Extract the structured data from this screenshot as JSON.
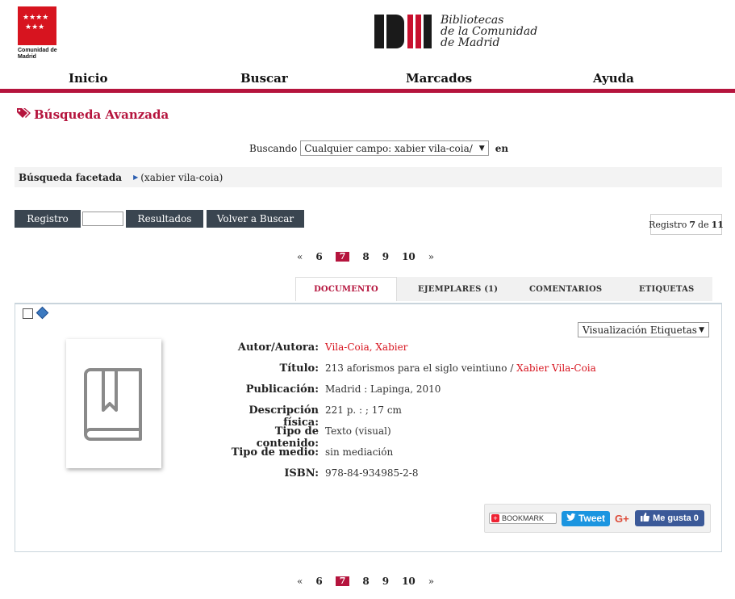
{
  "header": {
    "madrid_logo_caption": "Comunidad de Madrid",
    "library_logo_lines": [
      "Bibliotecas",
      "de la Comunidad",
      "de Madrid"
    ]
  },
  "nav": {
    "items": [
      "Inicio",
      "Buscar",
      "Marcados",
      "Ayuda"
    ]
  },
  "page_title": "Búsqueda Avanzada",
  "search": {
    "label": "Buscando",
    "selected": "Cualquier campo: xabier vila-coia/",
    "suffix": "en"
  },
  "facet": {
    "label": "Búsqueda facetada",
    "value": "(xabier vila-coia)"
  },
  "toolbar": {
    "registro": "Registro",
    "resultados": "Resultados",
    "volver": "Volver a Buscar",
    "registro_input": ""
  },
  "record_count": {
    "prefix": "Registro",
    "current": "7",
    "of": "de",
    "total": "11"
  },
  "pager": {
    "prev": "«",
    "pages": [
      "6",
      "7",
      "8",
      "9",
      "10"
    ],
    "current": "7",
    "next": "»"
  },
  "tabs": [
    "DOCUMENTO",
    "EJEMPLARES (1)",
    "COMENTARIOS",
    "ETIQUETAS"
  ],
  "view_select": "Visualización Etiquetas",
  "record": {
    "autor_label": "Autor/Autora:",
    "autor": "Vila-Coia, Xabier",
    "titulo_label": "Título:",
    "titulo": "213 aforismos para el siglo veintiuno",
    "titulo_sep": " / ",
    "titulo_author": "Xabier Vila-Coia",
    "publicacion_label": "Publicación:",
    "publicacion": "Madrid : Lapinga, 2010",
    "descripcion_label": "Descripción física:",
    "descripcion": "221 p. : ; 17 cm",
    "contenido_label": "Tipo de contenido:",
    "contenido": "Texto (visual)",
    "medio_label": "Tipo de medio:",
    "medio": "sin mediación",
    "isbn_label": "ISBN:",
    "isbn": "978-84-934985-2-8"
  },
  "share": {
    "bookmark": "BOOKMARK",
    "tweet": "Tweet",
    "gplus": "G+",
    "fb": "Me gusta 0"
  },
  "colors": {
    "accent": "#b5143d",
    "madrid_red": "#d7141f",
    "button_dark": "#3a4550"
  }
}
